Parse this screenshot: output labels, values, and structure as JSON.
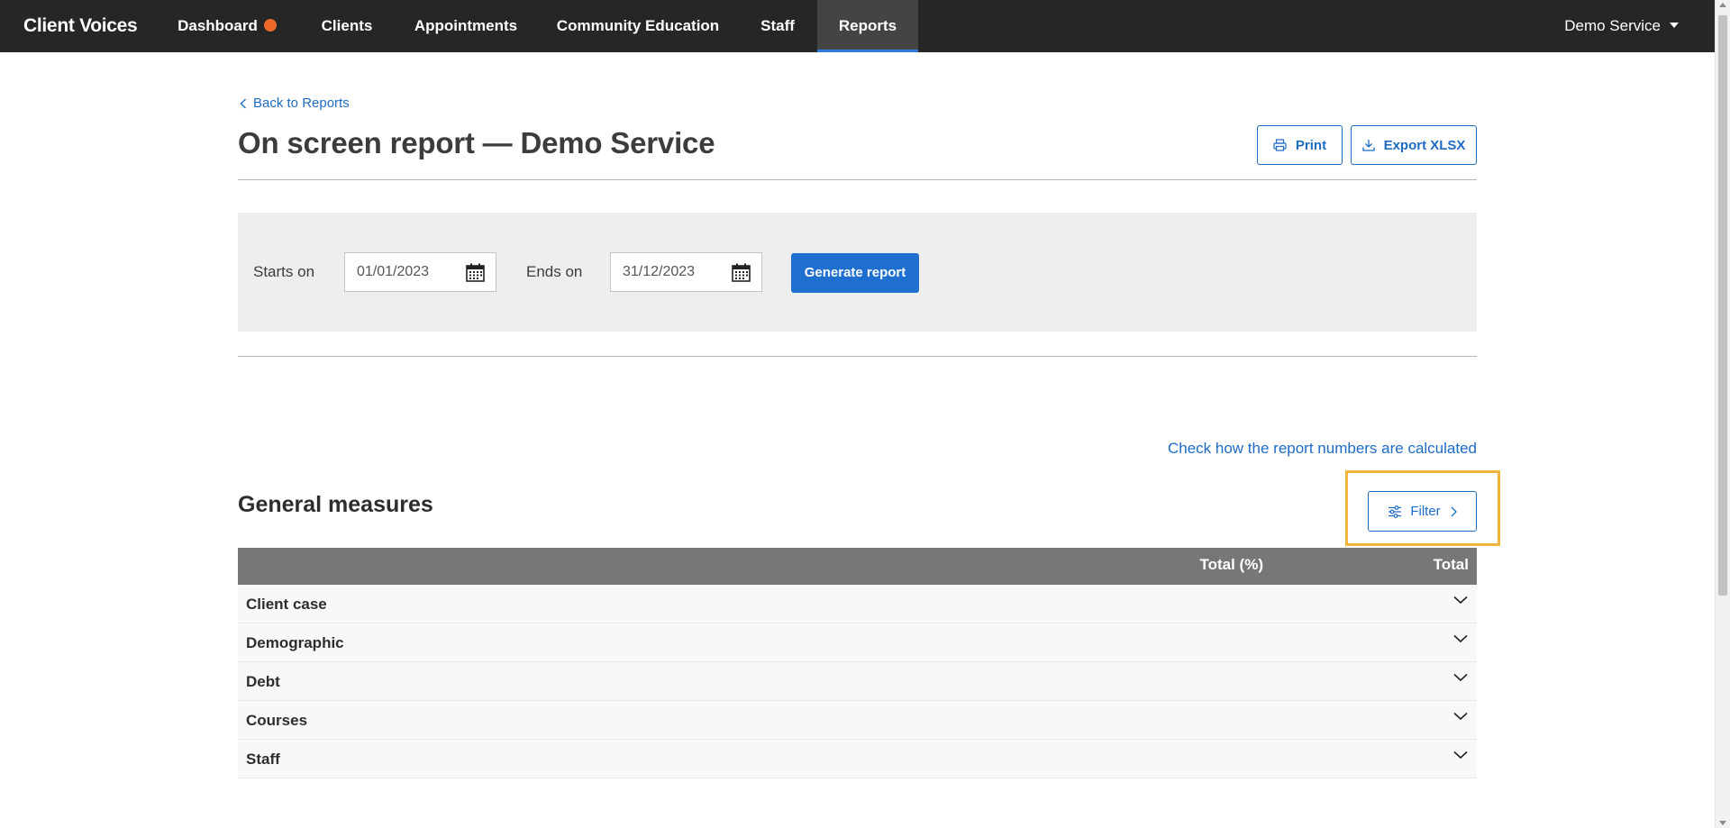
{
  "nav": {
    "brand": "Client Voices",
    "items": [
      {
        "label": "Dashboard"
      },
      {
        "label": "Clients"
      },
      {
        "label": "Appointments"
      },
      {
        "label": "Community Education"
      },
      {
        "label": "Staff"
      },
      {
        "label": "Reports"
      }
    ],
    "active": "Reports",
    "dashboard_dot_color": "#ec6a2a",
    "service_menu": "Demo Service"
  },
  "page": {
    "back_link": "Back to Reports",
    "title": "On screen report — Demo Service",
    "print_label": "Print",
    "export_label": "Export XLSX"
  },
  "filters": {
    "start_label": "Starts on",
    "start_value": "01/01/2023",
    "end_label": "Ends on",
    "end_value": "31/12/2023",
    "generate_label": "Generate report"
  },
  "calc_link": "Check how the report numbers are calculated",
  "section": {
    "title": "General measures",
    "filter_label": "Filter"
  },
  "table": {
    "columns": [
      "Total (%)",
      "Total"
    ],
    "rows": [
      {
        "label": "Client case"
      },
      {
        "label": "Demographic"
      },
      {
        "label": "Debt"
      },
      {
        "label": "Courses"
      },
      {
        "label": "Staff"
      }
    ]
  },
  "colors": {
    "accent": "#1e6bc4",
    "nav_bg": "#262626",
    "highlight": "#f1b43d"
  }
}
